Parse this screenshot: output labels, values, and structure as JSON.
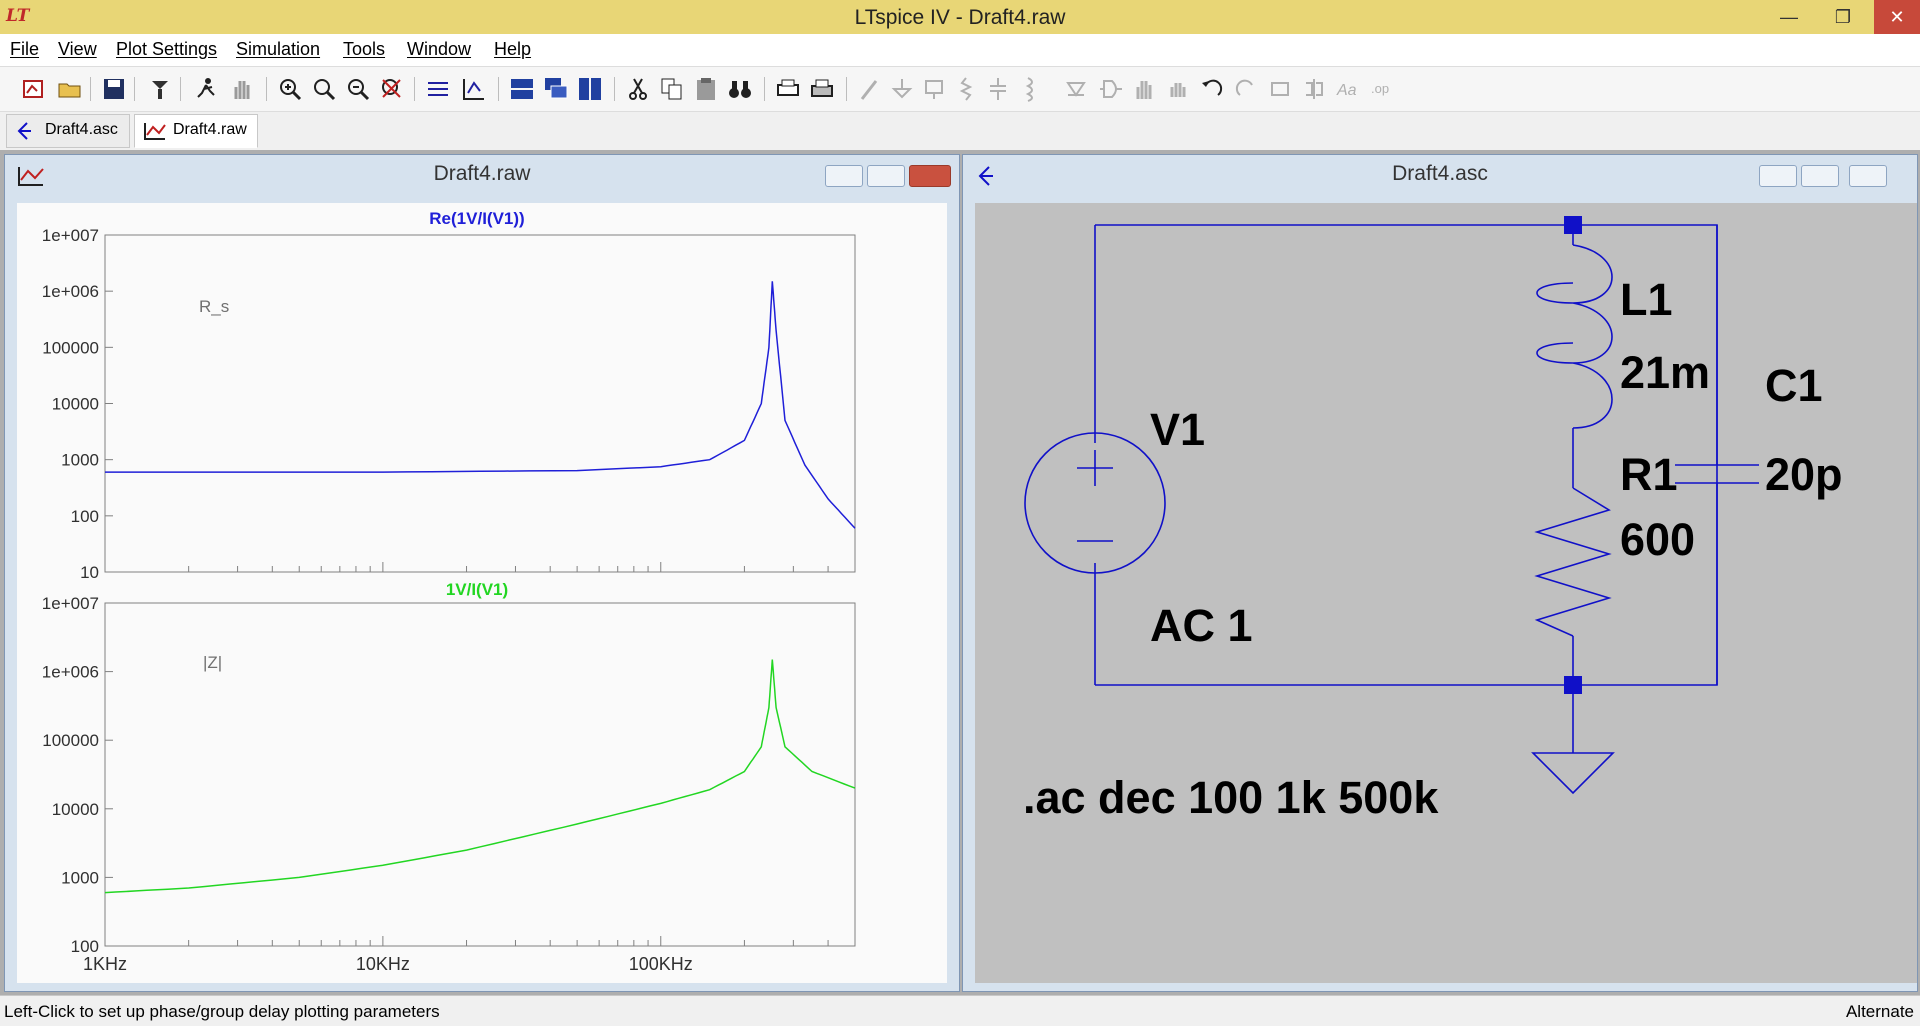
{
  "window": {
    "title": "LTspice IV - Draft4.raw",
    "app_icon": "LT"
  },
  "menu": [
    "File",
    "View",
    "Plot Settings",
    "Simulation",
    "Tools",
    "Window",
    "Help"
  ],
  "tabs": [
    {
      "label": "Draft4.asc",
      "icon": "schematic-icon"
    },
    {
      "label": "Draft4.raw",
      "icon": "waveform-icon"
    }
  ],
  "plot_window": {
    "title": "Draft4.raw",
    "top_pane": {
      "trace": "Re(1V/I(V1))",
      "note": "R_s",
      "color": "#1f1fd8",
      "yticks": [
        "1e+007",
        "1e+006",
        "100000",
        "10000",
        "1000",
        "100",
        "10"
      ]
    },
    "bottom_pane": {
      "trace": "1V/I(V1)",
      "note": "|Z|",
      "color": "#22d622",
      "yticks": [
        "1e+007",
        "1e+006",
        "100000",
        "10000",
        "1000",
        "100"
      ]
    },
    "xticks": [
      "1KHz",
      "10KHz",
      "100KHz"
    ]
  },
  "schematic_window": {
    "title": "Draft4.asc",
    "labels": {
      "v1": "V1",
      "v1_value": "AC 1",
      "l1": "L1",
      "l1_value": "21m",
      "r1": "R1",
      "r1_value": "600",
      "c1": "C1",
      "c1_value": "20p",
      "directive": ".ac dec 100 1k 500k"
    },
    "wire_color": "#1010c8"
  },
  "status": {
    "left": "Left-Click to set up phase/group delay plotting parameters",
    "right": "Alternate"
  },
  "chart_data": [
    {
      "type": "line",
      "title": "Re(1V/I(V1))",
      "xscale": "log",
      "yscale": "log",
      "xlim": [
        1000,
        500000
      ],
      "ylim": [
        10,
        10000000
      ],
      "series": [
        {
          "name": "Re(1V/I(V1))",
          "x": [
            1000,
            10000,
            50000,
            100000,
            150000,
            200000,
            230000,
            245000,
            252000,
            260000,
            280000,
            330000,
            400000,
            500000
          ],
          "y": [
            600,
            600,
            640,
            750,
            1000,
            2200,
            10000,
            100000,
            1500000,
            200000,
            5000,
            800,
            200,
            60
          ]
        }
      ],
      "annotations": [
        "R_s"
      ]
    },
    {
      "type": "line",
      "title": "1V/I(V1)",
      "xscale": "log",
      "yscale": "log",
      "xlim": [
        1000,
        500000
      ],
      "ylim": [
        100,
        10000000
      ],
      "series": [
        {
          "name": "1V/I(V1)",
          "x": [
            1000,
            2000,
            5000,
            10000,
            20000,
            50000,
            100000,
            150000,
            200000,
            230000,
            245000,
            252000,
            260000,
            280000,
            350000,
            500000
          ],
          "y": [
            600,
            700,
            1000,
            1500,
            2500,
            6000,
            12000,
            19000,
            35000,
            80000,
            300000,
            1500000,
            300000,
            80000,
            35000,
            20000
          ]
        }
      ],
      "annotations": [
        "|Z|"
      ]
    }
  ]
}
